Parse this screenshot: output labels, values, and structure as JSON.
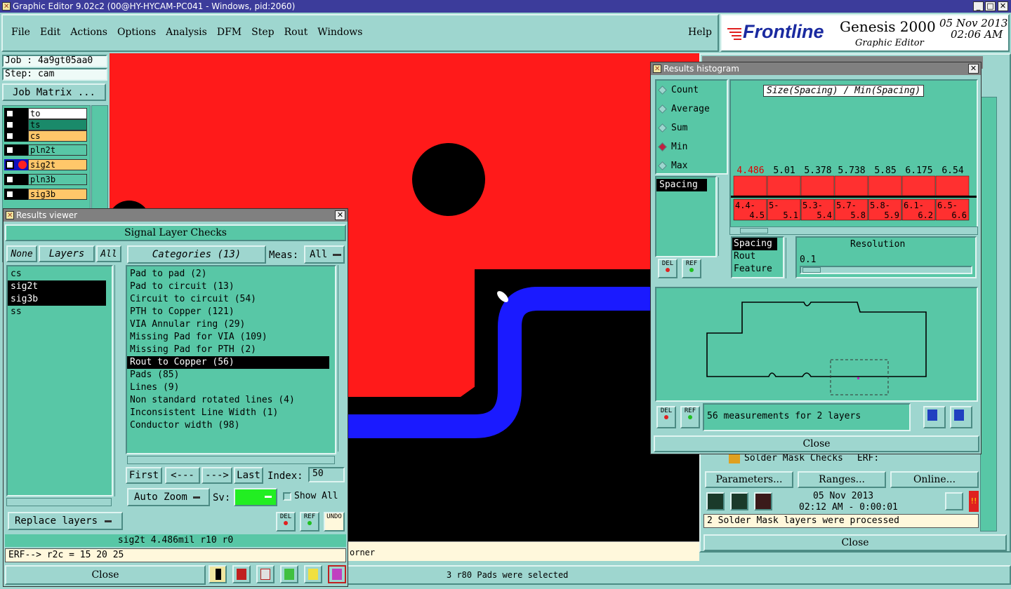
{
  "window": {
    "title": "Graphic Editor 9.02c2 (00@HY-HYCAM-PC041 - Windows, pid:2060)"
  },
  "menu": [
    "File",
    "Edit",
    "Actions",
    "Options",
    "Analysis",
    "DFM",
    "Step",
    "Rout",
    "Windows"
  ],
  "help_label": "Help",
  "brand": {
    "logo": "Frontline",
    "product": "Genesis 2000",
    "subtitle": "Graphic Editor",
    "date": "05 Nov 2013",
    "time": "02:06 AM"
  },
  "job": {
    "job_label": "Job : 4a9gt05aa0",
    "step_label": "Step: cam",
    "matrix_button": "Job Matrix ..."
  },
  "layers": [
    {
      "name": "to",
      "color": "#ffffff"
    },
    {
      "name": "ts",
      "color": "#1a8a6a"
    },
    {
      "name": "cs",
      "color": "#ffc76a"
    },
    {
      "name": "pln2t",
      "color": "#58c7a6"
    },
    {
      "name": "sig2t",
      "color": "#ffc76a"
    },
    {
      "name": "pln3b",
      "color": "#58c7a6"
    },
    {
      "name": "sig3b",
      "color": "#ffc76a"
    }
  ],
  "results_viewer": {
    "title": "Results viewer",
    "header": "Signal Layer Checks",
    "none_btn": "None",
    "layers_btn": "Layers",
    "all_btn": "All",
    "categories_btn": "Categories (13)",
    "meas_label": "Meas:",
    "meas_value": "All",
    "layer_list": [
      "cs",
      "sig2t",
      "sig3b",
      "ss"
    ],
    "categories": [
      "Pad to pad (2)",
      "Pad to circuit (13)",
      "Circuit to circuit (54)",
      "PTH to Copper (121)",
      "VIA Annular ring (29)",
      "Missing Pad for VIA (109)",
      "Missing Pad for PTH (2)",
      "Rout to Copper (56)",
      "Pads (85)",
      "Lines (9)",
      "Non standard rotated lines (4)",
      "Inconsistent Line Width (1)",
      "Conductor width (98)"
    ],
    "first_btn": "First",
    "prev_btn": "<---",
    "next_btn": "--->",
    "last_btn": "Last",
    "index_label": "Index:",
    "index_value": "50",
    "auto_zoom": "Auto Zoom",
    "sv_label": "Sv:",
    "show_all": "Show All",
    "replace_layers": "Replace layers",
    "del": "DEL",
    "ref": "REF",
    "undo": "UNDO",
    "status": "sig2t 4.486mil  r10  r0",
    "erf": "ERF--> r2c = 15 20 25",
    "close": "Close"
  },
  "histogram": {
    "title": "Results histogram",
    "modes": [
      "Count",
      "Average",
      "Sum",
      "Min",
      "Max"
    ],
    "selected_mode": "Min",
    "chart_title": "Size(Spacing) / Min(Spacing)",
    "measure_list": [
      "Spacing"
    ],
    "group_list": [
      "Spacing",
      "Rout",
      "Feature"
    ],
    "resolution_label": "Resolution",
    "resolution_value": "0.1",
    "summary": "56 measurements for 2 layers",
    "close": "Close",
    "del": "DEL",
    "ref": "REF"
  },
  "chart_data": {
    "type": "bar",
    "title": "Size(Spacing) / Min(Spacing)",
    "categories": [
      "4.4-4.5",
      "5-5.1",
      "5.3-5.4",
      "5.7-5.8",
      "5.8-5.9",
      "6.1-6.2",
      "6.5-6.6"
    ],
    "values": [
      4.486,
      5.01,
      5.378,
      5.738,
      5.85,
      6.175,
      6.54
    ],
    "value_labels": [
      "4.486",
      "5.01",
      "5.378",
      "5.738",
      "5.85",
      "6.175",
      "6.54"
    ],
    "bin_lines": [
      [
        "4.4-",
        "4.5"
      ],
      [
        "5-",
        "5.1"
      ],
      [
        "5.3-",
        "5.4"
      ],
      [
        "5.7-",
        "5.8"
      ],
      [
        "5.8-",
        "5.9"
      ],
      [
        "6.1-",
        "6.2"
      ],
      [
        "6.5-",
        "6.6"
      ]
    ],
    "bar_color": "#ff3030",
    "highlight_color": "#e00000"
  },
  "background_panel": {
    "solder_mask_label": "Solder Mask Checks",
    "erf_label": "ERF:",
    "parameters_btn": "Parameters...",
    "ranges_btn": "Ranges...",
    "online_btn": "Online...",
    "date": "05 Nov 2013",
    "time": "02:12 AM - 0:00:01",
    "message": "2 Solder Mask layers were processed",
    "close": "Close"
  },
  "bottom_status": {
    "corner_text": "orner",
    "selected_text": "3 r80 Pads were selected"
  }
}
